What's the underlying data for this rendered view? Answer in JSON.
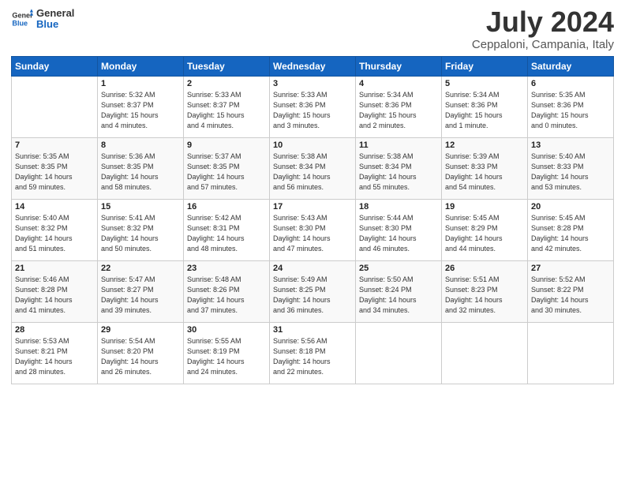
{
  "header": {
    "logo_general": "General",
    "logo_blue": "Blue",
    "month_title": "July 2024",
    "location": "Ceppaloni, Campania, Italy"
  },
  "days_of_week": [
    "Sunday",
    "Monday",
    "Tuesday",
    "Wednesday",
    "Thursday",
    "Friday",
    "Saturday"
  ],
  "weeks": [
    [
      {
        "day": "",
        "info": ""
      },
      {
        "day": "1",
        "info": "Sunrise: 5:32 AM\nSunset: 8:37 PM\nDaylight: 15 hours\nand 4 minutes."
      },
      {
        "day": "2",
        "info": "Sunrise: 5:33 AM\nSunset: 8:37 PM\nDaylight: 15 hours\nand 4 minutes."
      },
      {
        "day": "3",
        "info": "Sunrise: 5:33 AM\nSunset: 8:36 PM\nDaylight: 15 hours\nand 3 minutes."
      },
      {
        "day": "4",
        "info": "Sunrise: 5:34 AM\nSunset: 8:36 PM\nDaylight: 15 hours\nand 2 minutes."
      },
      {
        "day": "5",
        "info": "Sunrise: 5:34 AM\nSunset: 8:36 PM\nDaylight: 15 hours\nand 1 minute."
      },
      {
        "day": "6",
        "info": "Sunrise: 5:35 AM\nSunset: 8:36 PM\nDaylight: 15 hours\nand 0 minutes."
      }
    ],
    [
      {
        "day": "7",
        "info": "Sunrise: 5:35 AM\nSunset: 8:35 PM\nDaylight: 14 hours\nand 59 minutes."
      },
      {
        "day": "8",
        "info": "Sunrise: 5:36 AM\nSunset: 8:35 PM\nDaylight: 14 hours\nand 58 minutes."
      },
      {
        "day": "9",
        "info": "Sunrise: 5:37 AM\nSunset: 8:35 PM\nDaylight: 14 hours\nand 57 minutes."
      },
      {
        "day": "10",
        "info": "Sunrise: 5:38 AM\nSunset: 8:34 PM\nDaylight: 14 hours\nand 56 minutes."
      },
      {
        "day": "11",
        "info": "Sunrise: 5:38 AM\nSunset: 8:34 PM\nDaylight: 14 hours\nand 55 minutes."
      },
      {
        "day": "12",
        "info": "Sunrise: 5:39 AM\nSunset: 8:33 PM\nDaylight: 14 hours\nand 54 minutes."
      },
      {
        "day": "13",
        "info": "Sunrise: 5:40 AM\nSunset: 8:33 PM\nDaylight: 14 hours\nand 53 minutes."
      }
    ],
    [
      {
        "day": "14",
        "info": "Sunrise: 5:40 AM\nSunset: 8:32 PM\nDaylight: 14 hours\nand 51 minutes."
      },
      {
        "day": "15",
        "info": "Sunrise: 5:41 AM\nSunset: 8:32 PM\nDaylight: 14 hours\nand 50 minutes."
      },
      {
        "day": "16",
        "info": "Sunrise: 5:42 AM\nSunset: 8:31 PM\nDaylight: 14 hours\nand 48 minutes."
      },
      {
        "day": "17",
        "info": "Sunrise: 5:43 AM\nSunset: 8:30 PM\nDaylight: 14 hours\nand 47 minutes."
      },
      {
        "day": "18",
        "info": "Sunrise: 5:44 AM\nSunset: 8:30 PM\nDaylight: 14 hours\nand 46 minutes."
      },
      {
        "day": "19",
        "info": "Sunrise: 5:45 AM\nSunset: 8:29 PM\nDaylight: 14 hours\nand 44 minutes."
      },
      {
        "day": "20",
        "info": "Sunrise: 5:45 AM\nSunset: 8:28 PM\nDaylight: 14 hours\nand 42 minutes."
      }
    ],
    [
      {
        "day": "21",
        "info": "Sunrise: 5:46 AM\nSunset: 8:28 PM\nDaylight: 14 hours\nand 41 minutes."
      },
      {
        "day": "22",
        "info": "Sunrise: 5:47 AM\nSunset: 8:27 PM\nDaylight: 14 hours\nand 39 minutes."
      },
      {
        "day": "23",
        "info": "Sunrise: 5:48 AM\nSunset: 8:26 PM\nDaylight: 14 hours\nand 37 minutes."
      },
      {
        "day": "24",
        "info": "Sunrise: 5:49 AM\nSunset: 8:25 PM\nDaylight: 14 hours\nand 36 minutes."
      },
      {
        "day": "25",
        "info": "Sunrise: 5:50 AM\nSunset: 8:24 PM\nDaylight: 14 hours\nand 34 minutes."
      },
      {
        "day": "26",
        "info": "Sunrise: 5:51 AM\nSunset: 8:23 PM\nDaylight: 14 hours\nand 32 minutes."
      },
      {
        "day": "27",
        "info": "Sunrise: 5:52 AM\nSunset: 8:22 PM\nDaylight: 14 hours\nand 30 minutes."
      }
    ],
    [
      {
        "day": "28",
        "info": "Sunrise: 5:53 AM\nSunset: 8:21 PM\nDaylight: 14 hours\nand 28 minutes."
      },
      {
        "day": "29",
        "info": "Sunrise: 5:54 AM\nSunset: 8:20 PM\nDaylight: 14 hours\nand 26 minutes."
      },
      {
        "day": "30",
        "info": "Sunrise: 5:55 AM\nSunset: 8:19 PM\nDaylight: 14 hours\nand 24 minutes."
      },
      {
        "day": "31",
        "info": "Sunrise: 5:56 AM\nSunset: 8:18 PM\nDaylight: 14 hours\nand 22 minutes."
      },
      {
        "day": "",
        "info": ""
      },
      {
        "day": "",
        "info": ""
      },
      {
        "day": "",
        "info": ""
      }
    ]
  ]
}
